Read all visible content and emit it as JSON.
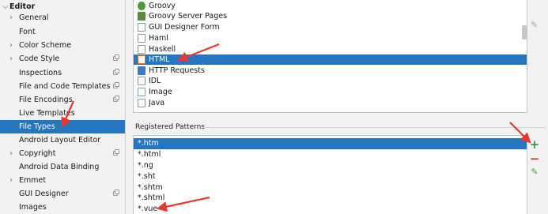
{
  "sidebar": {
    "items": [
      {
        "label": "Editor",
        "level": 0,
        "expanded": true,
        "bold": true
      },
      {
        "label": "General",
        "level": 1,
        "collapsed": true
      },
      {
        "label": "Font",
        "level": 1
      },
      {
        "label": "Color Scheme",
        "level": 1,
        "collapsed": true
      },
      {
        "label": "Code Style",
        "level": 1,
        "collapsed": true,
        "project_icon": true
      },
      {
        "label": "Inspections",
        "level": 1,
        "project_icon": true
      },
      {
        "label": "File and Code Templates",
        "level": 1,
        "project_icon": true
      },
      {
        "label": "File Encodings",
        "level": 1,
        "project_icon": true
      },
      {
        "label": "Live Templates",
        "level": 1
      },
      {
        "label": "File Types",
        "level": 1,
        "selected": true
      },
      {
        "label": "Android Layout Editor",
        "level": 1
      },
      {
        "label": "Copyright",
        "level": 1,
        "collapsed": true,
        "project_icon": true
      },
      {
        "label": "Android Data Binding",
        "level": 1
      },
      {
        "label": "Emmet",
        "level": 1,
        "collapsed": true
      },
      {
        "label": "GUI Designer",
        "level": 1,
        "project_icon": true
      },
      {
        "label": "Images",
        "level": 1
      }
    ]
  },
  "file_types": {
    "items": [
      {
        "label": "Groovy",
        "icon": "groovy-icon",
        "color": "#4c9a3c"
      },
      {
        "label": "Groovy Server Pages",
        "icon": "gsp-icon",
        "color": "#5a8a3a"
      },
      {
        "label": "GUI Designer Form",
        "icon": "form-icon",
        "color": "#7a9ab8"
      },
      {
        "label": "Haml",
        "icon": "haml-icon",
        "color": "#8a9ab0"
      },
      {
        "label": "Haskell",
        "icon": "haskell-icon",
        "color": "#8a9ab0"
      },
      {
        "label": "HTML",
        "icon": "html-icon",
        "color": "#e06b3a",
        "selected": true
      },
      {
        "label": "HTTP Requests",
        "icon": "http-icon",
        "color": "#3a7ac8"
      },
      {
        "label": "IDL",
        "icon": "idl-icon",
        "color": "#8a9ab0"
      },
      {
        "label": "Image",
        "icon": "image-icon",
        "color": "#6aa0c8"
      },
      {
        "label": "Java",
        "icon": "java-icon",
        "color": "#8a9ab0"
      }
    ]
  },
  "registered_patterns": {
    "title": "Registered Patterns",
    "items": [
      {
        "label": "*.htm",
        "selected": true
      },
      {
        "label": "*.html"
      },
      {
        "label": "*.ng"
      },
      {
        "label": "*.sht"
      },
      {
        "label": "*.shtm"
      },
      {
        "label": "*.shtml"
      },
      {
        "label": "*.vue"
      }
    ]
  },
  "toolbar": {
    "add_label": "+",
    "remove_label": "−",
    "edit_label": "✎",
    "top_add_label": "+",
    "top_remove_label": "−",
    "top_edit_label": "✎"
  },
  "colors": {
    "selection": "#2675bf",
    "annotation_arrow": "#e53a2f",
    "add": "#3a9a3a",
    "remove": "#c8372d"
  }
}
